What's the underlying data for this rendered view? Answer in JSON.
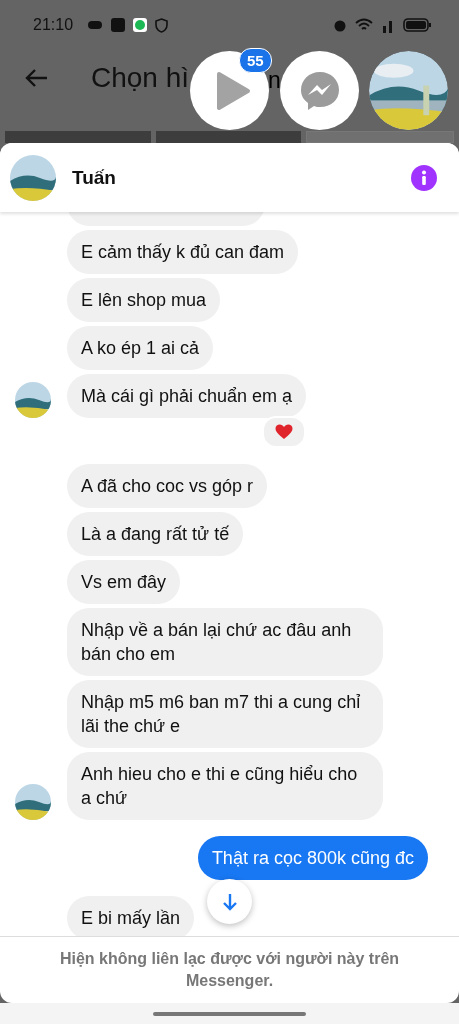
{
  "status_bar": {
    "time": "21:10"
  },
  "background_screen": {
    "title_parts": [
      "Chọn hì",
      "n"
    ]
  },
  "chat_heads": {
    "badge": "55"
  },
  "chat": {
    "contact_name": "Tuấn",
    "messages": [
      {
        "kind": "received"
      },
      {
        "kind": "received",
        "text": "E cảm thấy k đủ can đam"
      },
      {
        "kind": "received",
        "text": "E lên shop mua"
      },
      {
        "kind": "received",
        "text": "A ko ép 1 ai cả"
      },
      {
        "kind": "received",
        "text": "Mà cái gì phải chuẩn em ạ",
        "avatar": true,
        "reacted": true
      },
      {
        "kind": "received",
        "text": "A đã cho coc vs góp r"
      },
      {
        "kind": "received",
        "text": "Là a đang rất tử tế"
      },
      {
        "kind": "received",
        "text": "Vs em đây"
      },
      {
        "kind": "received",
        "text": "Nhập về a bán lại chứ ac đâu anh bán cho em"
      },
      {
        "kind": "received",
        "text": "Nhập m5 m6 ban m7 thi a cung chỉ lãi the chứ e"
      },
      {
        "kind": "received",
        "text": "Anh hieu cho e thi e cũng hiểu cho a chứ",
        "avatar": true
      },
      {
        "kind": "sent",
        "text": "Thật ra cọc 800k cũng đc"
      },
      {
        "kind": "received",
        "text": "E bi mấy lần"
      }
    ],
    "notice": "Hiện không liên lạc được với người này trên Messenger."
  }
}
